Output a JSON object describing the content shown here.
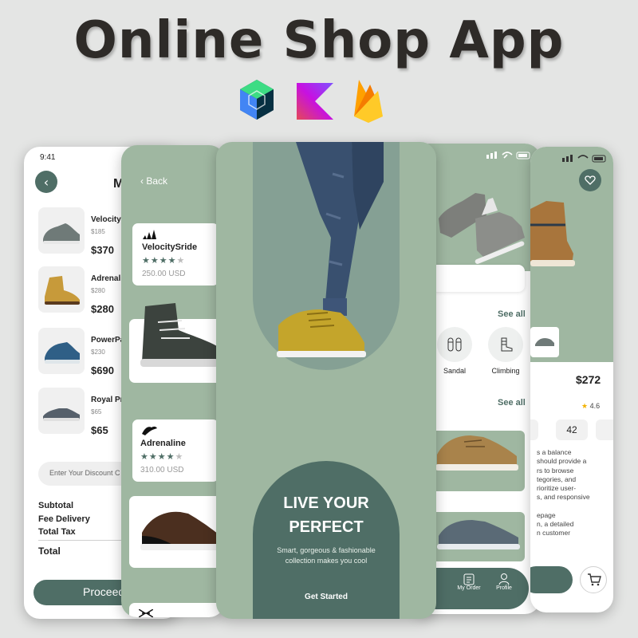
{
  "title": "Online Shop App",
  "tech_icons": [
    "jetpack-compose-icon",
    "kotlin-icon",
    "firebase-icon"
  ],
  "colors": {
    "primary": "#4f6e66",
    "sage": "#9fb7a1",
    "background": "#e4e5e4"
  },
  "cart_screen": {
    "time": "9:41",
    "title_partial": "M",
    "items": [
      {
        "name": "VelocityS",
        "sub": "$185",
        "price": "$370"
      },
      {
        "name": "Adrenali",
        "sub": "$280",
        "price": "$280"
      },
      {
        "name": "PowerPa",
        "sub": "$230",
        "price": "$690"
      },
      {
        "name": "Royal Pri",
        "sub": "$65",
        "price": "$65"
      }
    ],
    "discount_placeholder": "Enter Your Discount C",
    "subtotal_label": "Subtotal",
    "delivery_label": "Fee Delivery",
    "tax_label": "Total Tax",
    "total_label": "Total",
    "proceed_label": "Proceed"
  },
  "list_screen": {
    "back_label": "Back",
    "products": [
      {
        "name": "VelocitySride",
        "rating": 4,
        "price": "250.00 USD"
      },
      {
        "name": "Adrenaline",
        "rating": 4,
        "price": "310.00 USD"
      }
    ]
  },
  "intro_screen": {
    "headline_line1": "LIVE YOUR",
    "headline_line2": "PERFECT",
    "subtitle_line1": "Smart, gorgeous & fashionable",
    "subtitle_line2": "collection makes you cool",
    "cta": "Get Started"
  },
  "home_screen": {
    "see_all_1": "See all",
    "see_all_2": "See all",
    "categories": [
      "Sandal",
      "Climbing"
    ],
    "nav": [
      "My Order",
      "Profile"
    ]
  },
  "detail_screen": {
    "price": "$272",
    "rating": "4.6",
    "sizes": [
      "42"
    ],
    "description": [
      "s a balance",
      "should provide a",
      "rs to browse",
      "tegories, and",
      "rioritize user-",
      "s, and responsive",
      "",
      "epage",
      "n, a detailed",
      "n customer"
    ]
  }
}
